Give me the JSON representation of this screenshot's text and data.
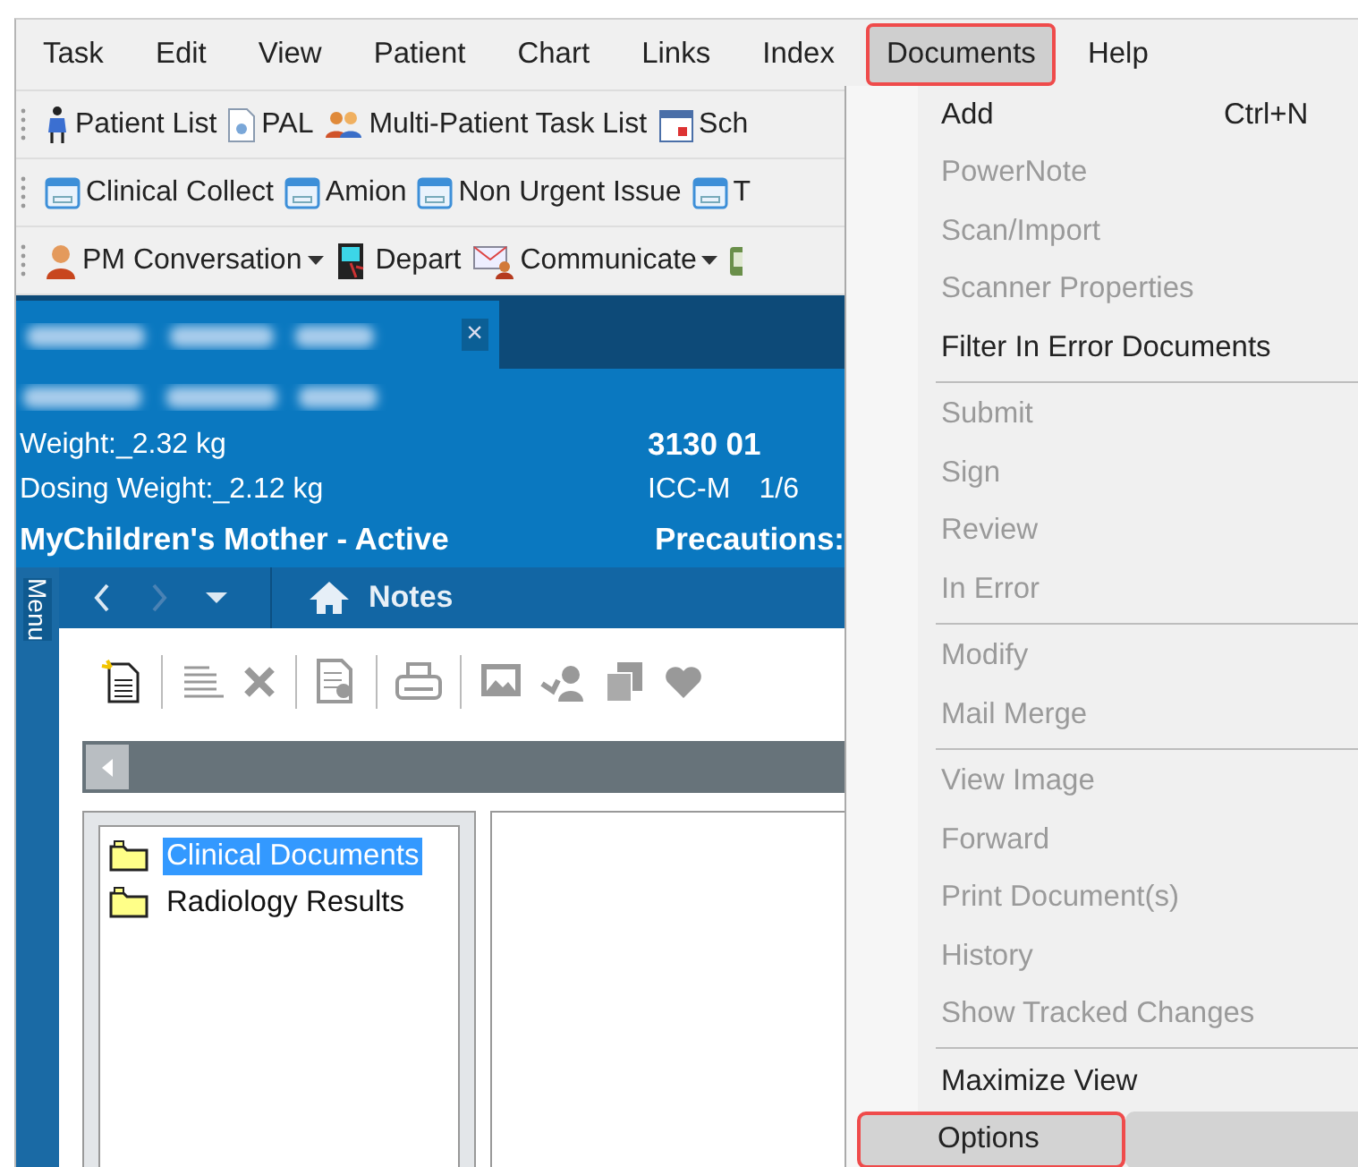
{
  "menu_bar": [
    {
      "label": "Task",
      "selected": false,
      "outlined": false
    },
    {
      "label": "Edit",
      "selected": false,
      "outlined": false
    },
    {
      "label": "View",
      "selected": false,
      "outlined": false
    },
    {
      "label": "Patient",
      "selected": false,
      "outlined": false
    },
    {
      "label": "Chart",
      "selected": false,
      "outlined": false
    },
    {
      "label": "Links",
      "selected": false,
      "outlined": false
    },
    {
      "label": "Index",
      "selected": false,
      "outlined": false
    },
    {
      "label": "Documents",
      "selected": true,
      "outlined": true
    },
    {
      "label": "Help",
      "selected": false,
      "outlined": false
    }
  ],
  "toolbars": [
    [
      {
        "label": "Patient List",
        "dropdown": false
      },
      {
        "label": "PAL",
        "dropdown": false
      },
      {
        "label": "Multi-Patient Task List",
        "dropdown": false
      },
      {
        "label": "Sch",
        "dropdown": false
      }
    ],
    [
      {
        "label": "Clinical Collect",
        "dropdown": false
      },
      {
        "label": "Amion",
        "dropdown": false
      },
      {
        "label": "Non Urgent Issue",
        "dropdown": false
      },
      {
        "label": "T",
        "dropdown": false
      }
    ],
    [
      {
        "label": "PM Conversation",
        "dropdown": true
      },
      {
        "label": "Depart",
        "dropdown": false
      },
      {
        "label": "Communicate",
        "dropdown": true
      },
      {
        "dropdown": false
      }
    ]
  ],
  "patient_tab": {
    "close_glyph": "×"
  },
  "patient_banner": {
    "weight": "Weight:_2.32 kg",
    "dosing_weight": "Dosing Weight:_2.12 kg",
    "room": "3130 01",
    "unit": "ICC-M",
    "bed": "1/6",
    "relation": "MyChildren's  Mother - Active",
    "precautions": "Precautions:"
  },
  "side_tab": "Menu",
  "nav_bar": {
    "title": "Notes"
  },
  "folders": [
    {
      "label": "Clinical Documents",
      "selected": true
    },
    {
      "label": "Radiology Results",
      "selected": false
    }
  ],
  "documents_menu": [
    [
      {
        "label": "Add",
        "shortcut": "Ctrl+N",
        "disabled": false,
        "selected": false,
        "outlined": false
      },
      {
        "label": "PowerNote",
        "disabled": true,
        "selected": false,
        "outlined": false
      },
      {
        "label": "Scan/Import",
        "disabled": true,
        "selected": false,
        "outlined": false
      },
      {
        "label": "Scanner Properties",
        "disabled": true,
        "selected": false,
        "outlined": false
      },
      {
        "label": "Filter In Error Documents",
        "disabled": false,
        "selected": false,
        "outlined": false
      }
    ],
    [
      {
        "label": "Submit",
        "disabled": true,
        "selected": false,
        "outlined": false
      },
      {
        "label": "Sign",
        "disabled": true,
        "selected": false,
        "outlined": false
      },
      {
        "label": "Review",
        "disabled": true,
        "selected": false,
        "outlined": false
      },
      {
        "label": "In Error",
        "disabled": true,
        "selected": false,
        "outlined": false
      }
    ],
    [
      {
        "label": "Modify",
        "disabled": true,
        "selected": false,
        "outlined": false
      },
      {
        "label": "Mail Merge",
        "disabled": true,
        "selected": false,
        "outlined": false
      }
    ],
    [
      {
        "label": "View Image",
        "disabled": true,
        "selected": false,
        "outlined": false
      },
      {
        "label": "Forward",
        "disabled": true,
        "selected": false,
        "outlined": false
      },
      {
        "label": "Print Document(s)",
        "disabled": true,
        "selected": false,
        "outlined": false
      },
      {
        "label": "History",
        "disabled": true,
        "selected": false,
        "outlined": false
      },
      {
        "label": "Show Tracked Changes",
        "disabled": true,
        "selected": false,
        "outlined": false
      }
    ],
    [
      {
        "label": "Maximize View",
        "disabled": false,
        "selected": false,
        "outlined": false
      },
      {
        "label": "Options",
        "disabled": false,
        "selected": true,
        "outlined": true
      }
    ]
  ]
}
